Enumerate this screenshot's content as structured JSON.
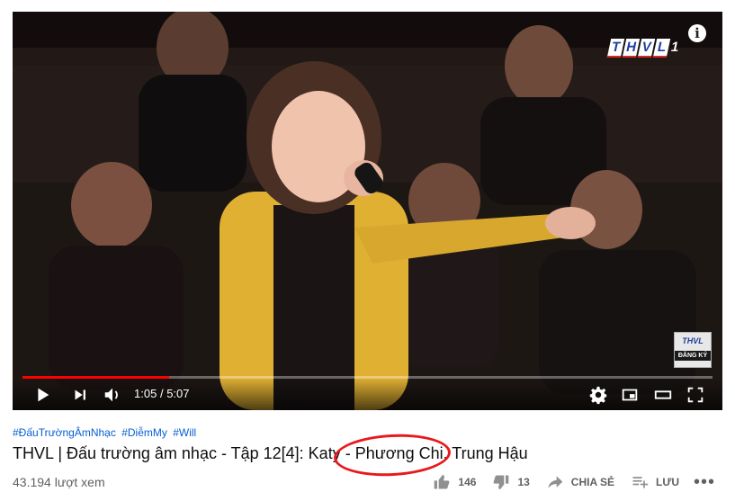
{
  "player": {
    "channel_logo": "THVL",
    "channel_logo_letters": [
      "T",
      "H",
      "V",
      "L"
    ],
    "channel_logo_number": "1",
    "info_icon": "info-icon",
    "watermark": {
      "logo": "THVL",
      "subscribe": "ĐĂNG KÝ"
    },
    "progress_fraction": 0.212,
    "time_current": "1:05",
    "time_separator": "/",
    "time_total": "5:07",
    "accent_color": "#ff0000"
  },
  "video": {
    "hashtags": [
      "#ĐấuTrườngÂmNhạc",
      "#DiễmMy",
      "#Will"
    ],
    "title": "THVL | Đấu trường âm nhạc - Tập 12[4]: Katy - Phương Chi, Trung Hậu",
    "views": "43.194 lượt xem"
  },
  "actions": {
    "like_count": "146",
    "dislike_count": "13",
    "share_label": "CHIA SẺ",
    "save_label": "LƯU",
    "more_label": "•••"
  }
}
